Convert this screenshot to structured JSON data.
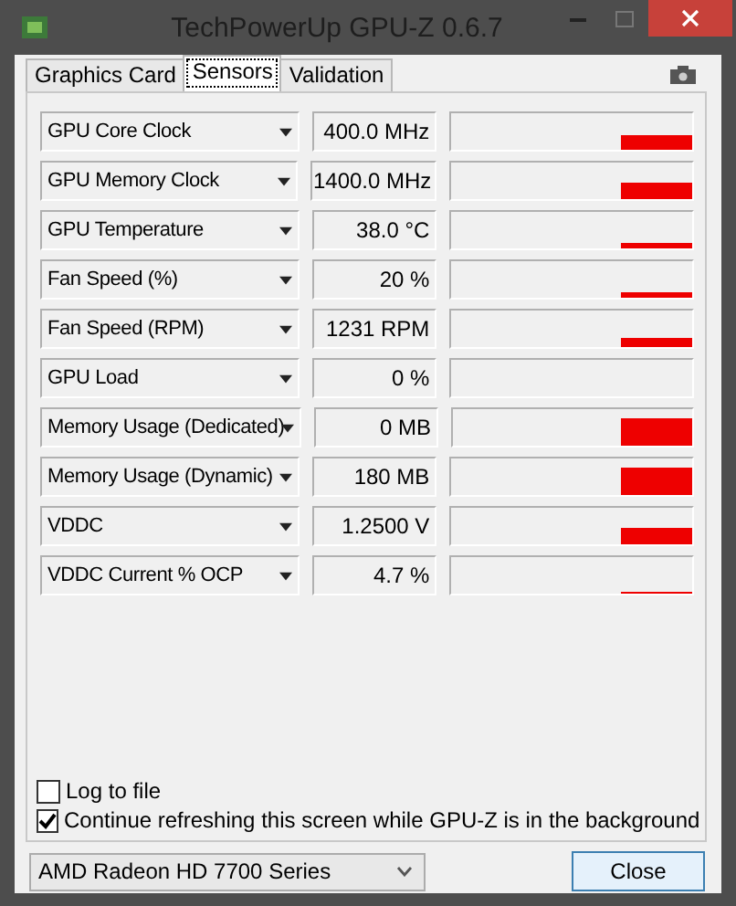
{
  "window": {
    "title": "TechPowerUp GPU-Z 0.6.7"
  },
  "tabs": [
    {
      "label": "Graphics Card",
      "selected": false
    },
    {
      "label": "Sensors",
      "selected": true
    },
    {
      "label": "Validation",
      "selected": false
    }
  ],
  "sensors": [
    {
      "name": "GPU Core Clock",
      "reading": "400.0 MHz"
    },
    {
      "name": "GPU Memory Clock",
      "reading": "1400.0 MHz"
    },
    {
      "name": "GPU Temperature",
      "reading": "38.0 °C"
    },
    {
      "name": "Fan Speed (%)",
      "reading": "20 %"
    },
    {
      "name": "Fan Speed (RPM)",
      "reading": "1231 RPM"
    },
    {
      "name": "GPU Load",
      "reading": "0 %"
    },
    {
      "name": "Memory Usage (Dedicated)",
      "reading": "0 MB"
    },
    {
      "name": "Memory Usage (Dynamic)",
      "reading": "180 MB"
    },
    {
      "name": "VDDC",
      "reading": "1.2500 V"
    },
    {
      "name": "VDDC Current % OCP",
      "reading": "4.7 %"
    }
  ],
  "options": [
    {
      "label": "Log to file",
      "checked": false
    },
    {
      "label": "Continue refreshing this screen while GPU-Z is in the background",
      "checked": true
    }
  ],
  "card_select": {
    "value": "AMD Radeon HD 7700 Series"
  },
  "buttons": [
    {
      "label": "Close"
    }
  ]
}
